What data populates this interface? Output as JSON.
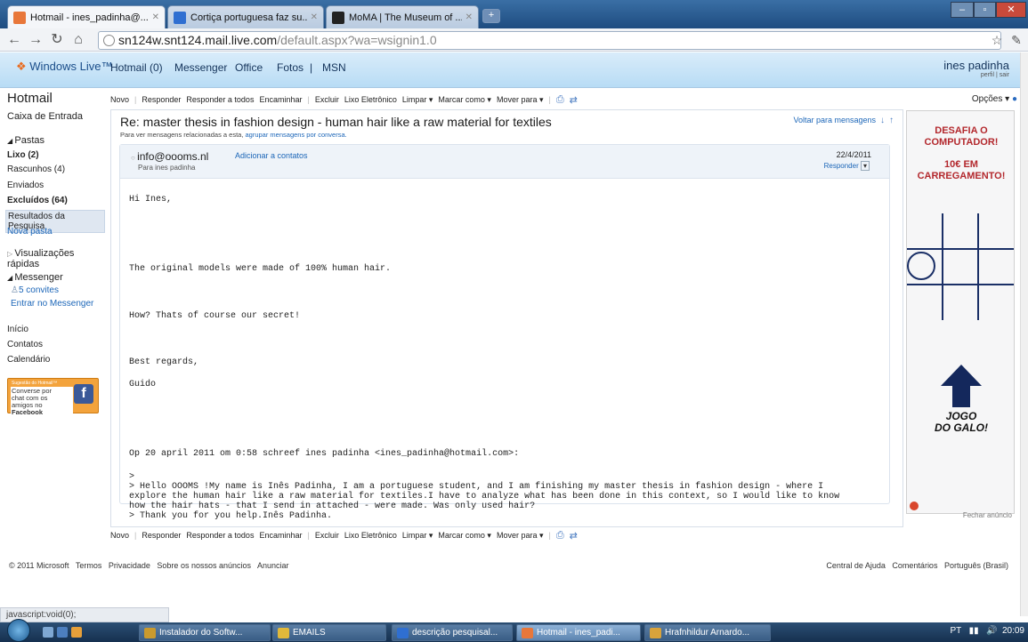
{
  "browser": {
    "tabs": [
      {
        "label": "Hotmail - ines_padinha@...",
        "active": true,
        "color": "#e8773a"
      },
      {
        "label": "Cortiça portuguesa faz su...",
        "active": false,
        "color": "#2f6fd1"
      },
      {
        "label": "MoMA | The Museum of ...",
        "active": false,
        "color": "#222222"
      }
    ],
    "url_host": "sn124w.snt124.mail.live.com",
    "url_path": "/default.aspx?wa=wsignin1.0",
    "status_text": "javascript:void(0);"
  },
  "wl_bar": {
    "logo": "Windows Live™",
    "items": [
      "Hotmail (0)",
      "Messenger",
      "Office",
      "Fotos",
      "|",
      "MSN"
    ],
    "user": "ines padinha",
    "user_sub": "perfil | sair"
  },
  "sidebar": {
    "title": "Hotmail",
    "inbox": "Caixa de Entrada",
    "pastas_header": "Pastas",
    "folders": [
      {
        "label": "Lixo (2)",
        "bold": true
      },
      {
        "label": "Rascunhos (4)",
        "bold": false
      },
      {
        "label": "Enviados",
        "bold": false
      },
      {
        "label": "Excluídos (64)",
        "bold": true
      },
      {
        "label": "Resultados da Pesquisa",
        "selected": true
      },
      {
        "label": "Nova pasta",
        "link": true
      }
    ],
    "quick_views": "Visualizações rápidas",
    "messenger_header": "Messenger",
    "invites": "5 convites",
    "enter_messenger": "Entrar no Messenger",
    "bottom": [
      "Início",
      "Contatos",
      "Calendário"
    ],
    "fb_small": "Sugestão do Hotmail™",
    "fb_text_1": "Converse por",
    "fb_text_2": "chat com os",
    "fb_text_3": "amigos no ",
    "fb_text_4": "Facebook"
  },
  "actions": {
    "items": [
      "Novo",
      "Responder",
      "Responder a todos",
      "Encaminhar",
      "Excluir",
      "Lixo Eletrônico",
      "Limpar ▾",
      "Marcar como ▾",
      "Mover para ▾"
    ],
    "options": "Opções ▾"
  },
  "message": {
    "subject": "Re: master thesis in fashion design - human hair like a raw material for textiles",
    "hint_text": "Para ver mensagens relacionadas a esta, ",
    "hint_link": "agrupar mensagens por conversa.",
    "back_link": "Voltar para mensagens",
    "sender": "info@oooms.nl",
    "add_contact": "Adicionar a contatos",
    "to": "Para ines padinha",
    "date": "22/4/2011",
    "reply": "Responder",
    "body_lines": [
      "Hi Ines,",
      "The original models were made of 100% human hair.",
      "How? Thats of course our secret!",
      "Best regards,",
      "Guido",
      "Op 20 april 2011 om 0:58 schreef ines padinha <ines_padinha@hotmail.com>:",
      ">",
      "> Hello OOOMS !My name is Inês Padinha, I am a portuguese student, and I am finishing my master thesis in fashion design - where I",
      "explore the human hair like a raw material for textiles.I have to analyze what has been done in this context, so I would like to know",
      "how the hair hats - that I send in attached - were made. Was only used hair?",
      "> Thank you for you help.Inês Padinha."
    ]
  },
  "ad": {
    "line1": "DESAFIA O",
    "line2": "COMPUTADOR!",
    "line3": "10€ EM",
    "line4": "CARREGAMENTO!",
    "game1": "JOGO",
    "game2": "DO GALO!",
    "close": "Fechar anúncio"
  },
  "footer": {
    "left": [
      "© 2011 Microsoft",
      "Termos",
      "Privacidade",
      "Sobre os nossos anúncios",
      "Anunciar"
    ],
    "right": [
      "Central de Ajuda",
      "Comentários",
      "Português (Brasil)"
    ]
  },
  "taskbar": {
    "items": [
      {
        "label": "Instalador do Softw...",
        "color": "#c99a2e"
      },
      {
        "label": "EMAILS",
        "color": "#e0b83a"
      },
      {
        "label": "descrição pesquisal...",
        "color": "#2f6fd1"
      },
      {
        "label": "Hotmail - ines_padi...",
        "color": "#e8773a",
        "active": true
      },
      {
        "label": "Hrafnhildur Arnardo...",
        "color": "#d9a33b"
      }
    ],
    "lang": "PT",
    "clock": "20:09"
  }
}
